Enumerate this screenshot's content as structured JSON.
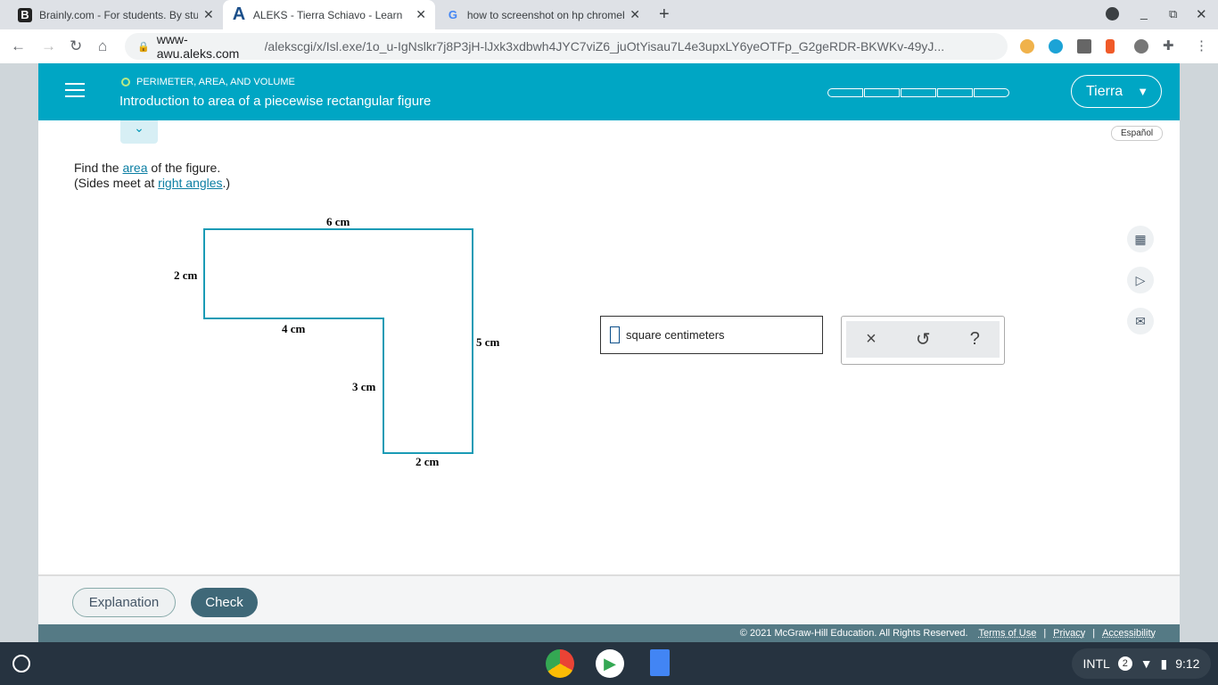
{
  "browser": {
    "tabs": [
      {
        "label": "Brainly.com - For students. By students.",
        "icon": "B"
      },
      {
        "label": "ALEKS - Tierra Schiavo - Learn",
        "icon": "A"
      },
      {
        "label": "how to screenshot on hp chromebook",
        "icon": "G"
      }
    ],
    "url_host": "www-awu.aleks.com",
    "url_path": "/alekscgi/x/Isl.exe/1o_u-IgNslkr7j8P3jH-lJxk3xdbwh4JYC7viZ6_juOtYisau7L4e3upxLY6yeOTFp_G2geRDR-BKWKv-49yJ..."
  },
  "header": {
    "topic": "PERIMETER, AREA, AND VOLUME",
    "title": "Introduction to area of a piecewise rectangular figure",
    "user": "Tierra",
    "progress_filled": 0,
    "progress_segments": 5
  },
  "espanol": "Español",
  "question": {
    "l1a": "Find the ",
    "l1link": "area",
    "l1b": " of the figure.",
    "l2a": "(Sides meet at ",
    "l2link": "right angles",
    "l2b": ".)"
  },
  "figure": {
    "labels": [
      "6 cm",
      "2 cm",
      "4 cm",
      "5 cm",
      "3 cm",
      "2 cm"
    ],
    "color": "#1a9bb5"
  },
  "answer": {
    "unit": "square centimeters",
    "value": ""
  },
  "tools": {
    "clear": "×",
    "undo": "↺",
    "help": "?"
  },
  "footer": {
    "explanation": "Explanation",
    "check": "Check"
  },
  "legal": {
    "copyright": "© 2021 McGraw-Hill Education. All Rights Reserved.",
    "terms": "Terms of Use",
    "privacy": "Privacy",
    "accessibility": "Accessibility",
    "sep": "|"
  },
  "tray": {
    "lang": "INTL",
    "badge": "2",
    "time": "9:12"
  }
}
